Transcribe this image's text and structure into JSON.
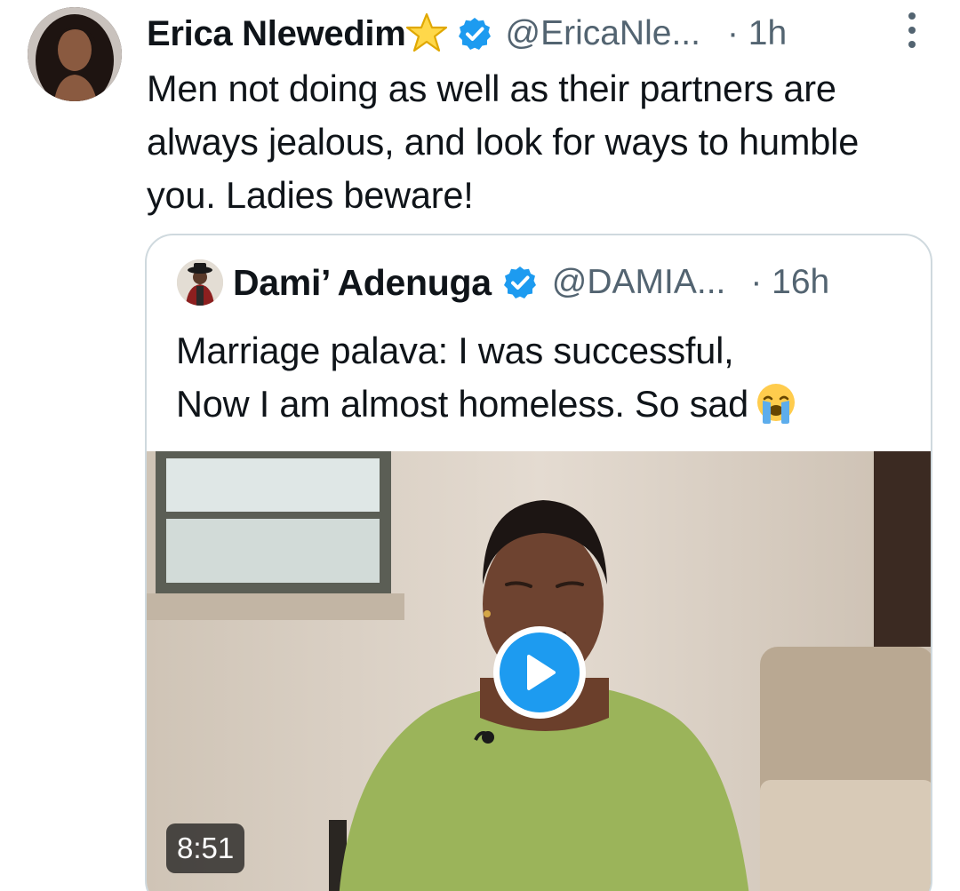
{
  "tweet": {
    "author_name": "Erica Nlewedim",
    "author_handle": "@EricaNle...",
    "time": "· 1h",
    "text": "Men not doing as well as their partners are always jealous, and look for ways to humble you. Ladies beware!",
    "icons": {
      "name_emoji": "star-icon",
      "verified": "verified-badge-icon",
      "more": "more-options-icon"
    }
  },
  "quote": {
    "author_name": "Dami’ Adenuga",
    "author_handle": "@DAMIA...",
    "time": "· 16h",
    "text_line1": "Marriage palava: I was successful,",
    "text_line2": "Now I am almost homeless. So sad",
    "emoji": "loudly-crying-face-icon",
    "video": {
      "duration": "8:51",
      "play_icon": "play-icon"
    }
  },
  "colors": {
    "accent": "#1d9bf0",
    "text": "#0f1419",
    "secondary": "#536471",
    "border": "#cfd9de"
  }
}
